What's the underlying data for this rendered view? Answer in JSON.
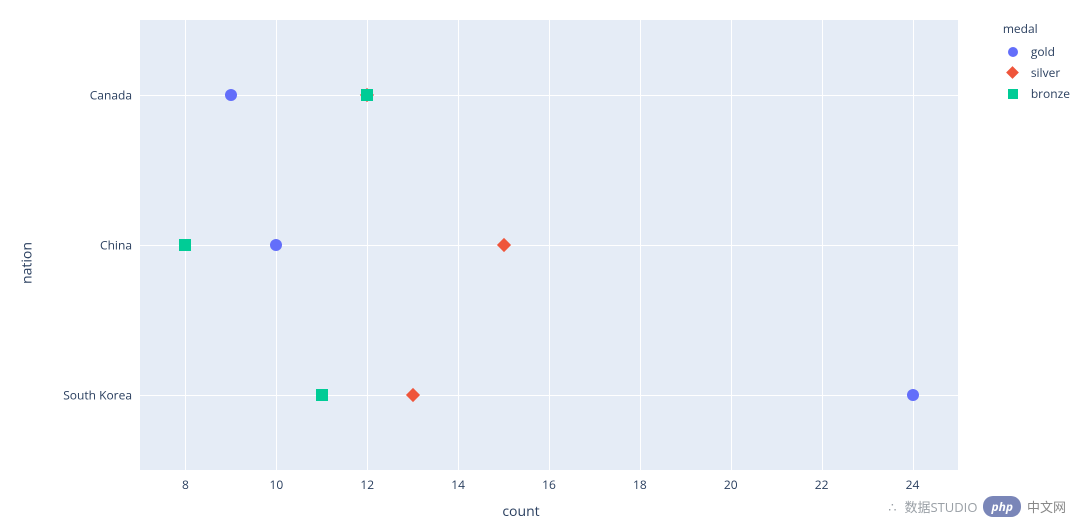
{
  "chart_data": {
    "type": "scatter",
    "categories": [
      "Canada",
      "China",
      "South Korea"
    ],
    "series": [
      {
        "name": "gold",
        "values": [
          9,
          10,
          24
        ],
        "color": "#636efa",
        "shape": "circle"
      },
      {
        "name": "silver",
        "values": [
          12,
          15,
          13
        ],
        "color": "#ef553b",
        "shape": "diamond"
      },
      {
        "name": "bronze",
        "values": [
          12,
          8,
          11
        ],
        "color": "#00cc96",
        "shape": "square"
      }
    ],
    "xlabel": "count",
    "ylabel": "nation",
    "xlim": [
      7,
      25
    ],
    "xticks": [
      8,
      10,
      12,
      14,
      16,
      18,
      20,
      22,
      24
    ],
    "legend_title": "medal"
  },
  "axis": {
    "x": {
      "label": "count",
      "ticks": [
        "8",
        "10",
        "12",
        "14",
        "16",
        "18",
        "20",
        "22",
        "24"
      ]
    },
    "y": {
      "label": "nation",
      "ticks": [
        "Canada",
        "China",
        "South Korea"
      ]
    }
  },
  "legend": {
    "title": "medal",
    "items": [
      {
        "label": "gold",
        "color": "#636efa",
        "shape": "circle"
      },
      {
        "label": "silver",
        "color": "#ef553b",
        "shape": "diamond"
      },
      {
        "label": "bronze",
        "color": "#00cc96",
        "shape": "square"
      }
    ]
  },
  "watermark": {
    "brand": "数据STUDIO",
    "badge": "php",
    "suffix": "中文网"
  }
}
